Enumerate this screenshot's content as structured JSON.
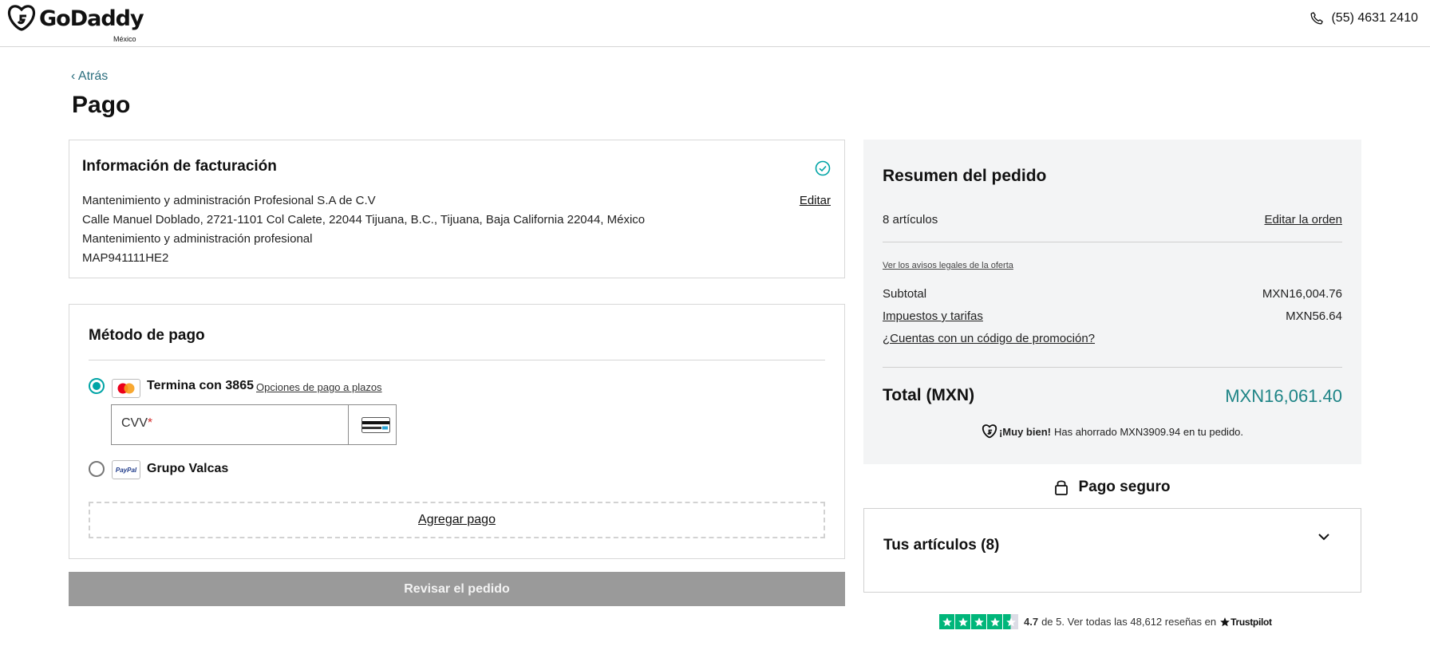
{
  "header": {
    "logo_text": "GoDaddy",
    "region": "México",
    "phone": "(55) 4631 2410"
  },
  "nav": {
    "back_label": "‹ Atrás",
    "page_title": "Pago"
  },
  "billing": {
    "title": "Información de facturación",
    "edit_label": "Editar",
    "lines": [
      "Mantenimiento y administración Profesional S.A de C.V",
      "Calle Manuel Doblado, 2721-1101 Col Calete, 22044 Tijuana, B.C., Tijuana, Baja California 22044, México",
      "Mantenimiento y administración profesional",
      "MAP941111HE2"
    ]
  },
  "payment": {
    "title": "Método de pago",
    "card_label": "Termina con 3865",
    "installments_link": "Opciones de pago a plazos",
    "cvv_label": "CVV",
    "cvv_required": "*",
    "cvv_value": "",
    "paypal_label": "Grupo Valcas",
    "paypal_brand": "PayPal",
    "add_payment_label": "Agregar pago",
    "selected_method": "card"
  },
  "review_button": "Revisar el pedido",
  "summary": {
    "title": "Resumen del pedido",
    "items_count": "8 artículos",
    "edit_order": "Editar la orden",
    "legal_link": "Ver los avisos legales de la oferta",
    "subtotal_label": "Subtotal",
    "subtotal_value": "MXN16,004.76",
    "taxes_label": "Impuestos y tarifas",
    "taxes_value": "MXN56.64",
    "promo_link": "¿Cuentas con un código de promoción?",
    "total_label": "Total (MXN)",
    "total_value": "MXN16,061.40",
    "savings_bold": "¡Muy bien!",
    "savings_text": "Has ahorrado MXN3909.94 en tu pedido."
  },
  "secure_label": "Pago seguro",
  "items_section": {
    "title": "Tus artículos (8)"
  },
  "trustpilot": {
    "rating": 4.7,
    "rating_text": "4.7",
    "of_text": "de 5.",
    "reviews_text": "Ver todas las 48,612 reseñas en",
    "brand": "Trustpilot"
  },
  "colors": {
    "accent_teal": "#00a4a6",
    "total_teal": "#1e8486",
    "back_link": "#2b6e7e",
    "disabled_button": "#9a9a9a",
    "summary_bg": "#f3f4f5",
    "trustpilot_green": "#00b67a"
  },
  "icons": {
    "logo": "godaddy-logo-icon",
    "phone": "phone-icon",
    "check": "check-circle-icon",
    "mastercard": "mastercard-icon",
    "paypal": "paypal-icon",
    "cvv": "card-back-icon",
    "lock": "lock-icon",
    "chevron": "chevron-down-icon",
    "star": "star-icon"
  }
}
